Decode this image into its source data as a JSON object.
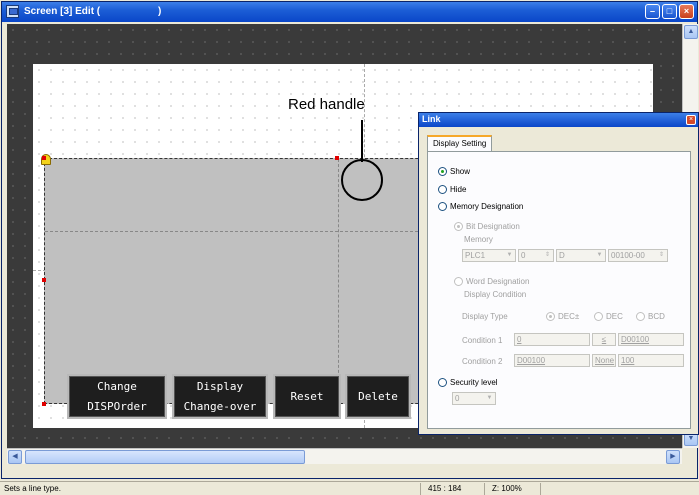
{
  "window": {
    "title": "Screen [3] Edit (",
    "title_suffix": ")",
    "controls": [
      "minimize",
      "maximize",
      "close"
    ]
  },
  "canvas": {
    "buttons": [
      {
        "line1": "Change",
        "line2": "DISPOrder"
      },
      {
        "line1": "Display",
        "line2": "Change-over"
      },
      {
        "line1": "Reset",
        "line2": ""
      },
      {
        "line1": "Delete",
        "line2": ""
      }
    ]
  },
  "callout": {
    "label": "Red handle"
  },
  "dialog": {
    "title": "Link",
    "tab": "Display Setting",
    "show_label": "Show",
    "hide_label": "Hide",
    "memory_designation_label": "Memory Designation",
    "bit_designation_label": "Bit Designation",
    "memory_label": "Memory",
    "plc_value": "PLC1",
    "num_value": "0",
    "device_value": "D",
    "address_value": "00100-00",
    "word_designation_label": "Word Designation",
    "display_condition_label": "Display Condition",
    "display_type_label": "Display Type",
    "dec_signed_label": "DEC±",
    "dec_label": "DEC",
    "bcd_label": "BCD",
    "condition1_label": "Condition 1",
    "condition1_value": "0",
    "condition1_op": "≤",
    "condition1_address": "D00100",
    "condition2_label": "Condition 2",
    "condition2_address": "D00100",
    "condition2_op": "None",
    "condition2_value": "100",
    "security_level_label": "Security level",
    "security_value": "0",
    "selected": "Show"
  },
  "status": {
    "message": "Sets a line type.",
    "coords": "415 : 184",
    "zoom": "Z: 100%"
  },
  "colors": {
    "title_bar": "#0a46c8",
    "handle": "#e00000",
    "canvas_button": "#1e1e1e",
    "part_fill": "#c0c0c0"
  }
}
